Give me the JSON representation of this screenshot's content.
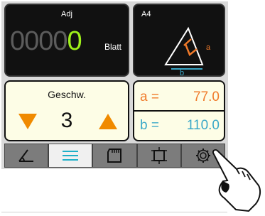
{
  "counter": {
    "title": "Adj",
    "digits_off": "0000",
    "digit_on": "0",
    "unit": "Blatt"
  },
  "angle": {
    "title": "A4",
    "label_a": "a",
    "label_b": "b"
  },
  "speed": {
    "title": "Geschw.",
    "value": "3"
  },
  "sides": {
    "a_label": "a =",
    "a_value": "77.0",
    "b_label": "b =",
    "b_value": "110.0"
  },
  "tabs": [
    {
      "icon": "angle-icon",
      "active": false
    },
    {
      "icon": "list-icon",
      "active": true
    },
    {
      "icon": "sd-card-icon",
      "active": false
    },
    {
      "icon": "crop-icon",
      "active": false
    },
    {
      "icon": "gear-icon",
      "active": false
    }
  ],
  "colors": {
    "counter_active": "#9ff11a",
    "arrow": "#f08a00",
    "a_color": "#f07a2a",
    "b_color": "#3aa8c8",
    "tab_active_icon": "#1fb0c8"
  }
}
